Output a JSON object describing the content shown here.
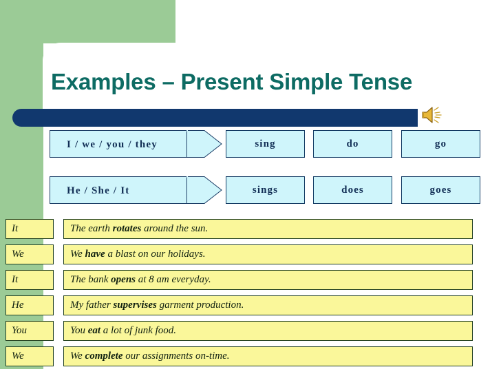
{
  "slide": {
    "title": "Examples – Present Simple Tense",
    "title_color": "#0D6B63",
    "accent_bar_color": "#11386E",
    "panel_green": "#9BCB96",
    "box_fill": "#CFF5FB",
    "table_fill": "#FAF79A",
    "audio_icon": "speaker-icon"
  },
  "conjugation": {
    "rows": [
      {
        "subjects": "I / we / you / they",
        "verbs": [
          "sing",
          "do",
          "go"
        ]
      },
      {
        "subjects": "He / She / It",
        "verbs": [
          "sings",
          "does",
          "goes"
        ]
      }
    ]
  },
  "examples": {
    "rows": [
      {
        "subject": "It",
        "before": "The earth ",
        "verb": "rotates",
        "after": " around the sun."
      },
      {
        "subject": "We",
        "before": "We ",
        "verb": "have",
        "after": " a blast on our holidays."
      },
      {
        "subject": "It",
        "before": "The bank ",
        "verb": "opens",
        "after": " at 8 am everyday."
      },
      {
        "subject": "He",
        "before": "My father ",
        "verb": "supervises",
        "after": " garment production."
      },
      {
        "subject": "You",
        "before": "You ",
        "verb": "eat",
        "after": " a lot of junk food."
      },
      {
        "subject": "We",
        "before": "We ",
        "verb": "complete",
        "after": " our assignments on-time."
      }
    ]
  }
}
